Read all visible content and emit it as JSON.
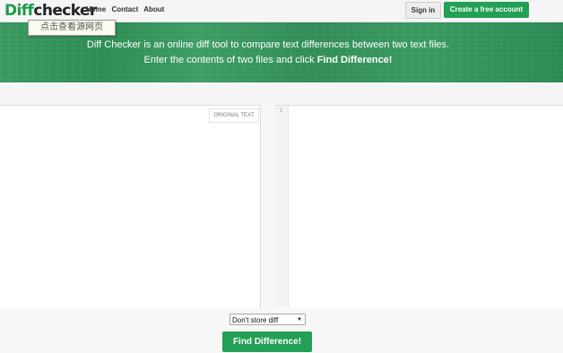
{
  "header": {
    "logo": {
      "part1": "Diff",
      "part2": "checker"
    },
    "nav": [
      "Home",
      "Contact",
      "About"
    ],
    "signin_label": "Sign in",
    "create_account_label": "Create a free account"
  },
  "tooltip": {
    "text": "点击查看源网页"
  },
  "banner": {
    "line1": "Diff Checker is an online diff tool to compare text differences between two text files.",
    "line2_prefix": "Enter the contents of two files and click ",
    "line2_bold": "Find Difference!"
  },
  "editor": {
    "left_label": "ORIGINAL TEXT",
    "right_line_number": "1"
  },
  "footer": {
    "store_select": {
      "selected": "Don't store diff"
    },
    "find_button_label": "Find Difference!"
  },
  "colors": {
    "brand_green": "#23a055",
    "banner_green": "#389a61"
  }
}
